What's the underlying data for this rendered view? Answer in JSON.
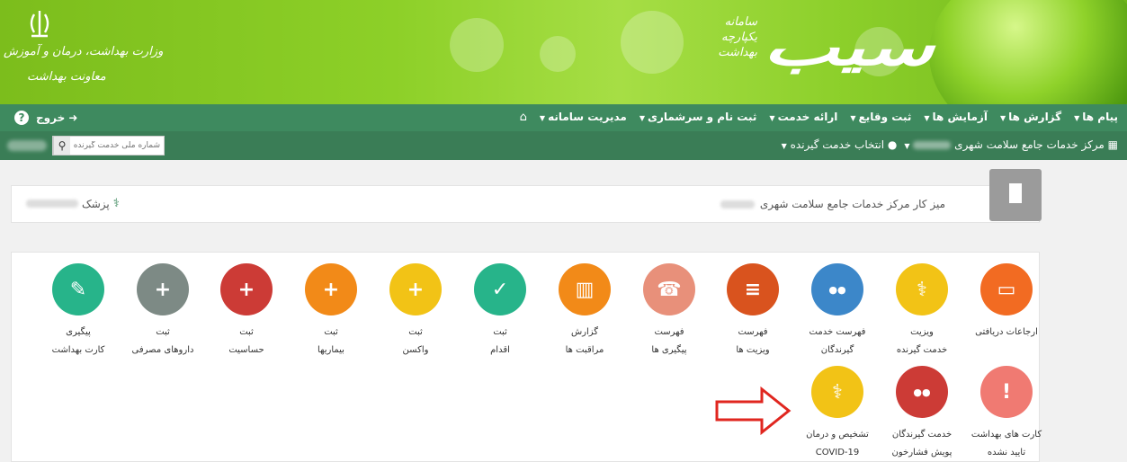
{
  "header": {
    "ministry_line1": "وزارت بهداشت، درمان و آموزش",
    "ministry_line2": "معاونت بهداشت",
    "system_line1": "سامانه",
    "system_line2": "یکپارچه",
    "system_line3": "بهداشت",
    "brand": "سیب"
  },
  "nav": {
    "home_icon": "home-icon",
    "menu": [
      {
        "label": "مدیریت سامانه"
      },
      {
        "label": "ثبت نام و سرشماری"
      },
      {
        "label": "ارائه خدمت"
      },
      {
        "label": "ثبت وقایع"
      },
      {
        "label": "آزمایش ها"
      },
      {
        "label": "گزارش ها"
      },
      {
        "label": "پیام ها"
      }
    ],
    "logout_label": "خروج",
    "help_label": "?"
  },
  "subnav": {
    "center_label": "مرکز خدمات جامع سلامت شهری",
    "select_client_label": "انتخاب خدمت گیرنده",
    "search_placeholder": "شماره ملی خدمت گیرنده"
  },
  "desk": {
    "title": "میز کار مرکز خدمات جامع سلامت شهری",
    "role_label": "پزشک"
  },
  "tiles": [
    {
      "line1": "ارجاعات دریافتی",
      "line2": "",
      "color": "#f26b22",
      "icon": "inbox-icon"
    },
    {
      "line1": "ویزیت",
      "line2": "خدمت گیرنده",
      "color": "#f2c316",
      "icon": "doctor-icon"
    },
    {
      "line1": "فهرست خدمت",
      "line2": "گیرندگان",
      "color": "#3c87c9",
      "icon": "users-icon"
    },
    {
      "line1": "فهرست",
      "line2": "ویزیت ها",
      "color": "#d9531e",
      "icon": "list-icon"
    },
    {
      "line1": "فهرست",
      "line2": "پیگیری ها",
      "color": "#e8907a",
      "icon": "phone-icon"
    },
    {
      "line1": "گزارش",
      "line2": "مراقبت ها",
      "color": "#f28a18",
      "icon": "bar-chart-icon"
    },
    {
      "line1": "ثبت",
      "line2": "اقدام",
      "color": "#27b48a",
      "icon": "check-icon"
    },
    {
      "line1": "ثبت",
      "line2": "واکسن",
      "color": "#f2c316",
      "icon": "plus-icon"
    },
    {
      "line1": "ثبت",
      "line2": "بیماریها",
      "color": "#f28a18",
      "icon": "plus-icon"
    },
    {
      "line1": "ثبت",
      "line2": "حساسیت",
      "color": "#cc3b36",
      "icon": "plus-icon"
    },
    {
      "line1": "ثبت",
      "line2": "داروهای مصرفی",
      "color": "#7d8a85",
      "icon": "plus-icon"
    },
    {
      "line1": "پیگیری",
      "line2": "کارت بهداشت",
      "color": "#27b48a",
      "icon": "edit-icon"
    },
    {
      "line1": "کارت های بهداشت",
      "line2": "تایید نشده",
      "color": "#f07a72",
      "icon": "warning-icon"
    },
    {
      "line1": "خدمت گیرندگان",
      "line2": "پویش فشارخون",
      "color": "#cc3b36",
      "icon": "users-icon"
    },
    {
      "line1": "تشخیص و درمان",
      "line2": "COVID-19",
      "color": "#f2c316",
      "icon": "doctor-icon"
    }
  ]
}
